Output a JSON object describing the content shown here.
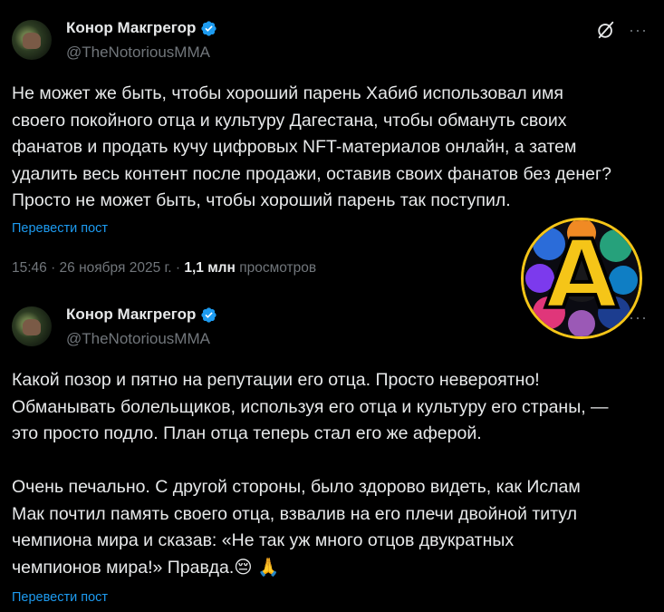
{
  "tweet1": {
    "author_name": "Конор Макгрегор",
    "handle": "@TheNotoriousMMA",
    "text": "Не может же быть, чтобы хороший парень Хабиб использовал имя\nсвоего покойного отца и культуру Дагестана, чтобы обмануть своих\nфанатов и продать кучу цифровых NFT-материалов онлайн, а затем\nудалить весь контент после продажи, оставив своих фанатов без денег?\nПросто не может быть, чтобы хороший парень так поступил.",
    "translate_label": "Перевести пост",
    "timestamp": "15:46 · 26 ноября 2025 г. ·",
    "views_count": "1,1 млн",
    "views_label": "просмотров"
  },
  "tweet2": {
    "author_name": "Конор Макгрегор",
    "handle": "@TheNotoriousMMA",
    "text": "Какой позор и пятно на репутации его отца. Просто невероятно!\nОбманывать болельщиков, используя его отца и культуру его страны, —\nэто просто подло. План отца теперь стал его же аферой.\n\nОчень печально. С другой стороны, было здорово видеть, как Ислам\nМак почтил память своего отца, взвалив на его плечи двойной титул\nчемпиона мира и сказав: «Не так уж много отцов двукратных\nчемпионов мира!» Правда.😔 🙏",
    "translate_label": "Перевести пост"
  },
  "icons": {
    "verified": "verified-badge-icon",
    "grok": "grok-icon",
    "more": "more-icon"
  },
  "colors": {
    "background": "#000000",
    "text": "#e7e9ea",
    "secondary": "#71767b",
    "link": "#1d9bf0",
    "verified": "#1d9bf0",
    "logo_accent": "#f5c518"
  },
  "watermark": {
    "letter": "A"
  }
}
